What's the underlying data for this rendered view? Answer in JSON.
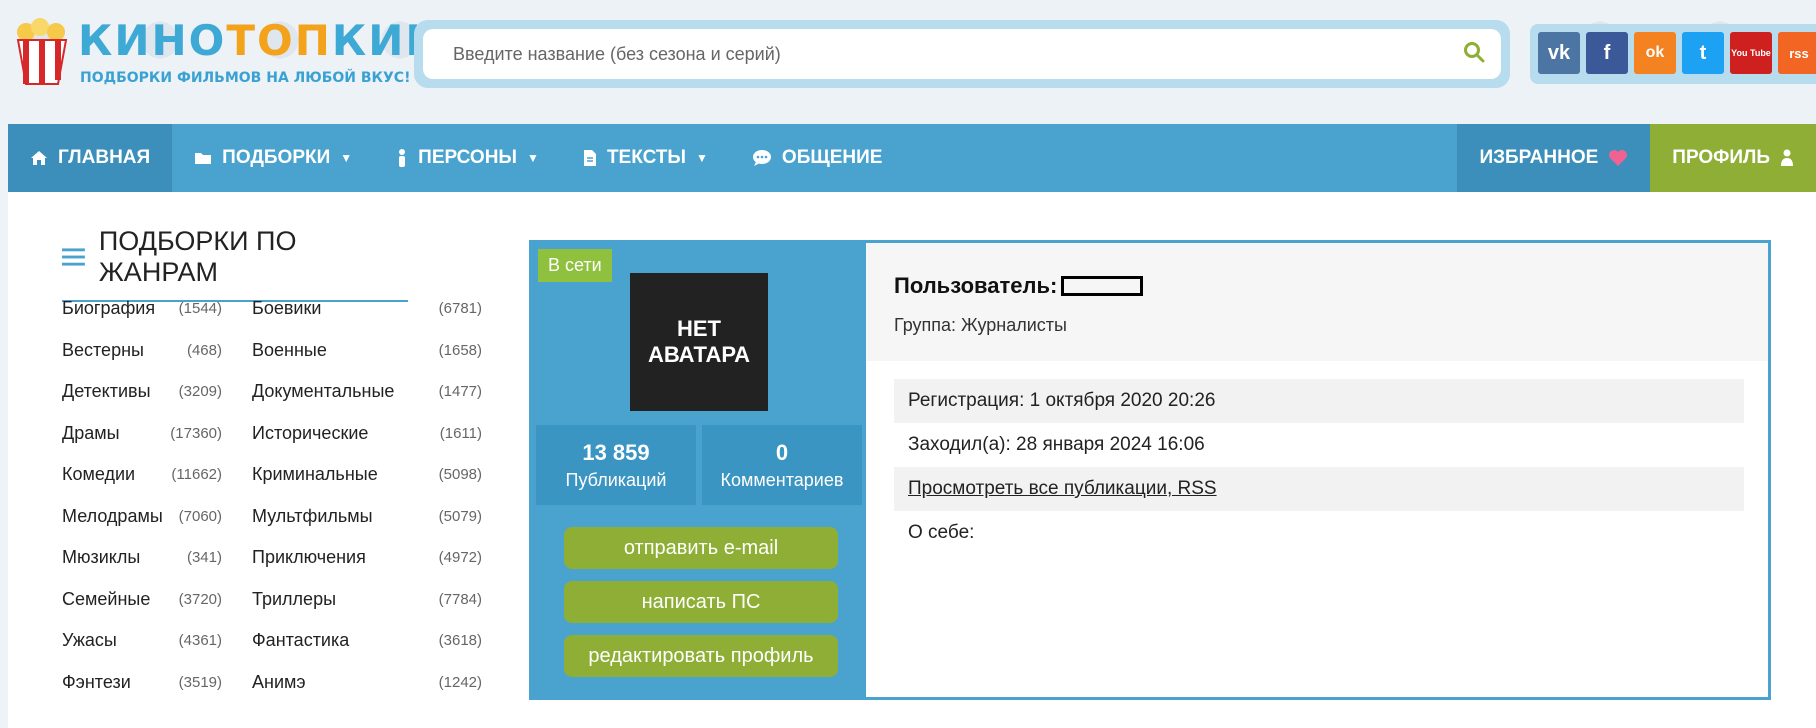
{
  "logo": {
    "title_part1": "КИНО",
    "title_part2": "ТОП",
    "title_part3": "КИН",
    "subtitle": "ПОДБОРКИ ФИЛЬМОВ НА ЛЮБОЙ ВКУС!"
  },
  "search": {
    "placeholder": "Введите название (без сезона и серий)",
    "icon": "search-icon"
  },
  "social": [
    {
      "name": "vk",
      "glyph": "vk",
      "color": "#4c75a3"
    },
    {
      "name": "facebook",
      "glyph": "f",
      "color": "#3b5998"
    },
    {
      "name": "odnoklassniki",
      "glyph": "ok",
      "color": "#f58220"
    },
    {
      "name": "twitter",
      "glyph": "t",
      "color": "#1da1f2"
    },
    {
      "name": "youtube",
      "glyph": "You Tube",
      "color": "#cd201f"
    },
    {
      "name": "rss",
      "glyph": "rss",
      "color": "#f26522"
    }
  ],
  "nav": {
    "home": "ГЛАВНАЯ",
    "collections": "ПОДБОРКИ",
    "persons": "ПЕРСОНЫ",
    "texts": "ТЕКСТЫ",
    "chat": "ОБЩЕНИЕ",
    "favorites": "ИЗБРАННОЕ",
    "profile": "ПРОФИЛЬ"
  },
  "sidebar": {
    "title": "ПОДБОРКИ ПО ЖАНРАМ",
    "genres": [
      {
        "name": "Биография",
        "count": "(1544)"
      },
      {
        "name": "Боевики",
        "count": "(6781)"
      },
      {
        "name": "Вестерны",
        "count": "(468)"
      },
      {
        "name": "Военные",
        "count": "(1658)"
      },
      {
        "name": "Детективы",
        "count": "(3209)"
      },
      {
        "name": "Документальные",
        "count": "(1477)"
      },
      {
        "name": "Драмы",
        "count": "(17360)"
      },
      {
        "name": "Исторические",
        "count": "(1611)"
      },
      {
        "name": "Комедии",
        "count": "(11662)"
      },
      {
        "name": "Криминальные",
        "count": "(5098)"
      },
      {
        "name": "Мелодрамы",
        "count": "(7060)"
      },
      {
        "name": "Мультфильмы",
        "count": "(5079)"
      },
      {
        "name": "Мюзиклы",
        "count": "(341)"
      },
      {
        "name": "Приключения",
        "count": "(4972)"
      },
      {
        "name": "Семейные",
        "count": "(3720)"
      },
      {
        "name": "Триллеры",
        "count": "(7784)"
      },
      {
        "name": "Ужасы",
        "count": "(4361)"
      },
      {
        "name": "Фантастика",
        "count": "(3618)"
      },
      {
        "name": "Фэнтези",
        "count": "(3519)"
      },
      {
        "name": "Анимэ",
        "count": "(1242)"
      }
    ]
  },
  "profile": {
    "online_badge": "В сети",
    "avatar_line1": "НЕТ",
    "avatar_line2": "АВАТАРА",
    "publications_count": "13 859",
    "publications_label": "Публикаций",
    "comments_count": "0",
    "comments_label": "Комментариев",
    "btn_email": "отправить e-mail",
    "btn_pm": "написать ПС",
    "btn_edit": "редактировать профиль",
    "user_label": "Пользователь:",
    "group": "Группа: Журналисты",
    "registration": "Регистрация: 1 октября 2020 20:26",
    "last_visit": "Заходил(а): 28 января 2024 16:06",
    "all_publications_link": "Просмотреть все публикации, RSS",
    "about": "О себе:"
  },
  "colors": {
    "nav_blue": "#4aa3cf",
    "nav_dark": "#3b8fba",
    "green": "#8fae35",
    "online_green": "#8fc13e",
    "heart": "#f06292"
  }
}
